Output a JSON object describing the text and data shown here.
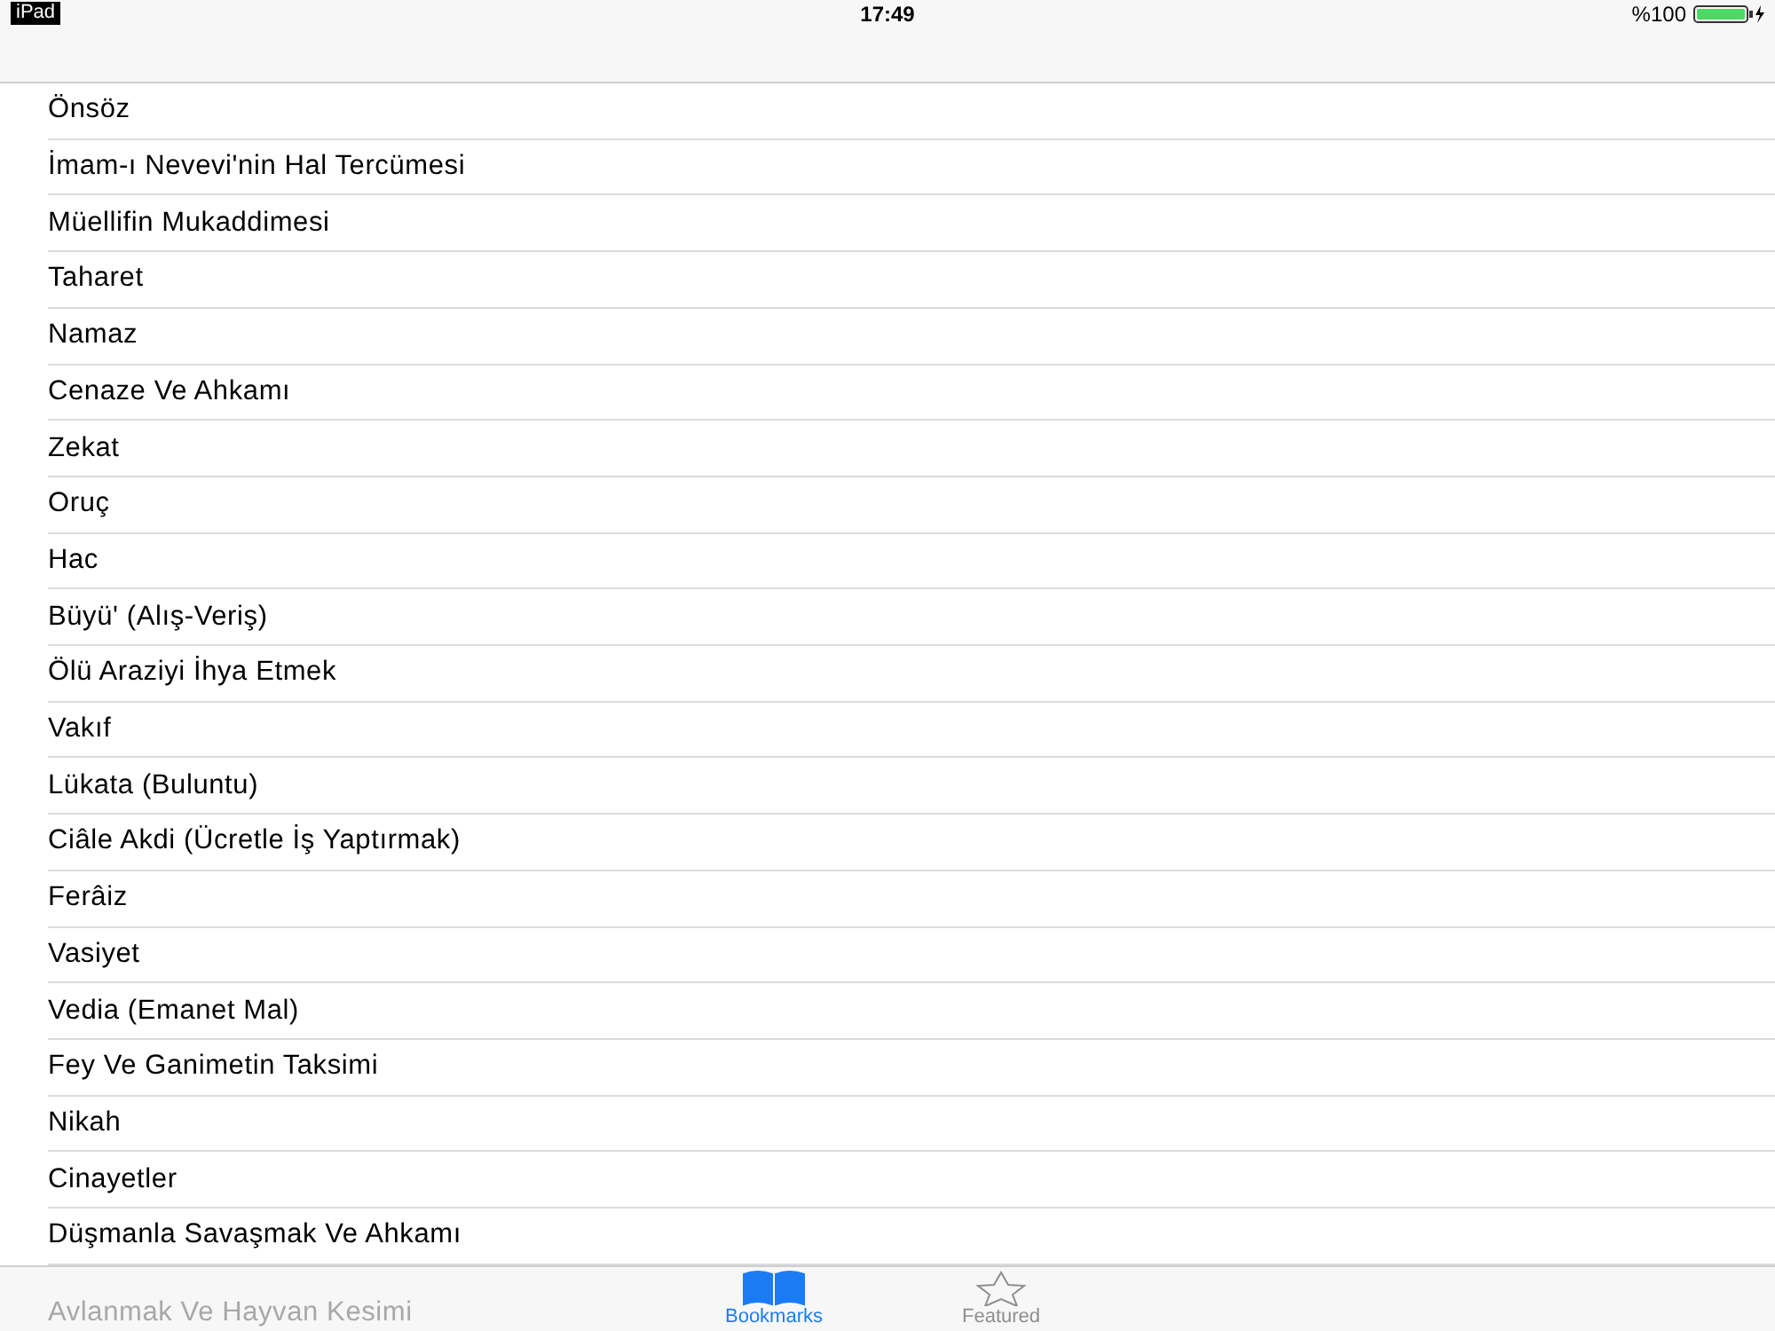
{
  "status_bar": {
    "device": "iPad",
    "time": "17:49",
    "battery": "%100"
  },
  "chapters": [
    {
      "title": "Önsöz"
    },
    {
      "title": "İmam-ı Nevevi'nin Hal Tercümesi"
    },
    {
      "title": "Müellifin Mukaddimesi"
    },
    {
      "title": "Taharet"
    },
    {
      "title": "Namaz"
    },
    {
      "title": "Cenaze Ve Ahkamı"
    },
    {
      "title": "Zekat"
    },
    {
      "title": "Oruç"
    },
    {
      "title": "Hac"
    },
    {
      "title": "Büyü' (Alış-Veriş)"
    },
    {
      "title": "Ölü Araziyi İhya Etmek"
    },
    {
      "title": "Vakıf"
    },
    {
      "title": "Lükata (Buluntu)"
    },
    {
      "title": "Ciâle Akdi (Ücretle İş Yaptırmak)"
    },
    {
      "title": "Ferâiz"
    },
    {
      "title": "Vasiyet"
    },
    {
      "title": "Vedia (Emanet Mal)"
    },
    {
      "title": "Fey Ve Ganimetin Taksimi"
    },
    {
      "title": "Nikah"
    },
    {
      "title": "Cinayetler"
    },
    {
      "title": "Düşmanla Savaşmak Ve Ahkamı"
    },
    {
      "title": "Avlanmak Ve Hayvan Kesimi"
    }
  ],
  "tab_bar": [
    {
      "label": "Bookmarks",
      "kind": "book",
      "selected": true
    },
    {
      "label": "Featured",
      "kind": "star",
      "selected": false
    }
  ]
}
